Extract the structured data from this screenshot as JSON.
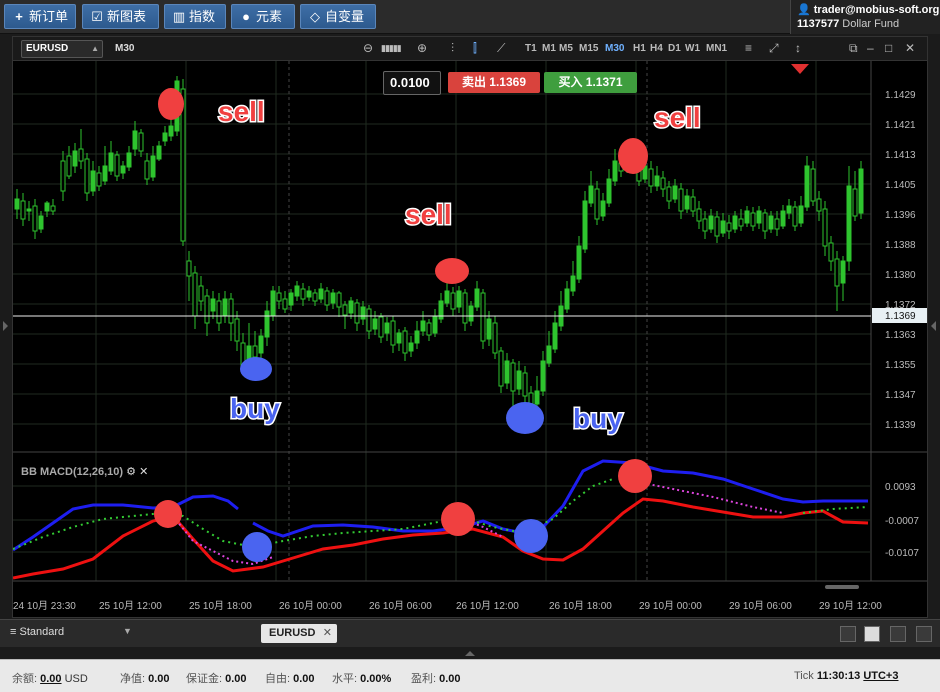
{
  "toolbar": {
    "new_order": "新订单",
    "new_chart": "新图表",
    "indicators": "指数",
    "elements": "元素",
    "variables": "自变量"
  },
  "account": {
    "email": "trader@mobius-soft.org",
    "number": "1137577",
    "fund": "Dollar Fund"
  },
  "chart": {
    "symbol": "EURUSD",
    "timeframe": "M30",
    "timeframes": [
      "T1",
      "M1",
      "M5",
      "M15",
      "M30",
      "H1",
      "H4",
      "D1",
      "W1",
      "MN1"
    ],
    "active_timeframe": "M30",
    "lot": "0.0100",
    "sell_label": "卖出 1.1369",
    "buy_label": "买入 1.1371",
    "current_price_label": "1.1369",
    "price_ticks": [
      "1.1429",
      "1.1421",
      "1.1413",
      "1.1405",
      "1.1396",
      "1.1388",
      "1.1380",
      "1.1372",
      "1.1363",
      "1.1355",
      "1.1347",
      "1.1339"
    ],
    "indicator_label": "BB MACD(12,26,10)",
    "macd_ticks": [
      "0.0093",
      "-0.0007",
      "-0.0107"
    ],
    "time_labels": [
      "24 10月 23:30",
      "25 10月 12:00",
      "25 10月 18:00",
      "26 10月 00:00",
      "26 10月 06:00",
      "26 10月 12:00",
      "26 10月 18:00",
      "29 10月 00:00",
      "29 10月 06:00",
      "29 10月 12:00"
    ],
    "annotations": [
      {
        "text": "sell",
        "color": "#f04040"
      },
      {
        "text": "sell",
        "color": "#f04040"
      },
      {
        "text": "sell",
        "color": "#f04040"
      },
      {
        "text": "buy",
        "color": "#4a64f0"
      },
      {
        "text": "buy",
        "color": "#4a64f0"
      }
    ]
  },
  "tabs": {
    "workspace": "Standard",
    "chart_tab": "EURUSD"
  },
  "status": {
    "balance_label": "余额:",
    "balance_value": "0.00",
    "balance_currency": "USD",
    "equity_label": "净值:",
    "equity_value": "0.00",
    "margin_label": "保证金:",
    "margin_value": "0.00",
    "free_label": "自由:",
    "free_value": "0.00",
    "level_label": "水平:",
    "level_value": "0.00%",
    "profit_label": "盈利:",
    "profit_value": "0.00",
    "tick_label": "Tick",
    "time_value": "11:30:13",
    "timezone": "UTC+3"
  },
  "colors": {
    "bull": "#22c322",
    "bear": "#1a7a1a",
    "macd_blue": "#1e1ef0",
    "macd_red": "#ee1111",
    "signal_green": "#33cc33",
    "signal_magenta": "#dd44dd",
    "marker_red": "#f04040",
    "marker_blue": "#4a64f0"
  }
}
